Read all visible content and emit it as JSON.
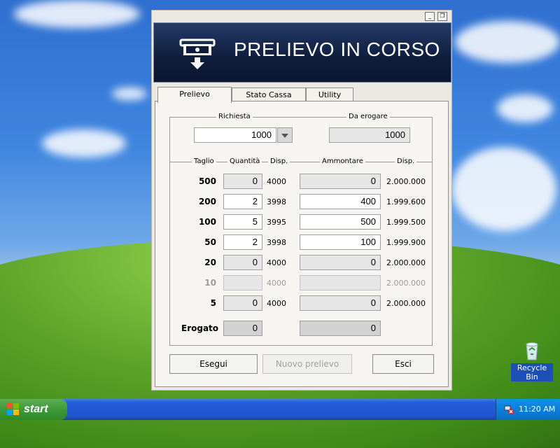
{
  "window": {
    "banner_title": "PRELIEVO IN CORSO",
    "minimize_glyph": "_",
    "restore_glyph": "❐"
  },
  "tabs": [
    {
      "label": "Prelievo",
      "active": true
    },
    {
      "label": "Stato Cassa",
      "active": false
    },
    {
      "label": "Utility",
      "active": false
    }
  ],
  "request": {
    "richiesta_label": "Richiesta",
    "richiesta_value": "1000",
    "da_erogare_label": "Da erogare",
    "da_erogare_value": "1000"
  },
  "table": {
    "headers": {
      "taglio": "Taglio",
      "quantita": "Quantità",
      "disp": "Disp.",
      "ammontare": "Ammontare",
      "disp2": "Disp."
    },
    "rows": [
      {
        "taglio": "500",
        "quantita": "0",
        "disp": "4000",
        "ammontare": "0",
        "disp_amount": "2.000.000",
        "enabled": true
      },
      {
        "taglio": "200",
        "quantita": "2",
        "disp": "3998",
        "ammontare": "400",
        "disp_amount": "1.999.600",
        "enabled": true
      },
      {
        "taglio": "100",
        "quantita": "5",
        "disp": "3995",
        "ammontare": "500",
        "disp_amount": "1.999.500",
        "enabled": true
      },
      {
        "taglio": "50",
        "quantita": "2",
        "disp": "3998",
        "ammontare": "100",
        "disp_amount": "1.999.900",
        "enabled": true
      },
      {
        "taglio": "20",
        "quantita": "0",
        "disp": "4000",
        "ammontare": "0",
        "disp_amount": "2.000.000",
        "enabled": true
      },
      {
        "taglio": "10",
        "quantita": "",
        "disp": "4000",
        "ammontare": "",
        "disp_amount": "2.000.000",
        "enabled": false
      },
      {
        "taglio": "5",
        "quantita": "0",
        "disp": "4000",
        "ammontare": "0",
        "disp_amount": "2.000.000",
        "enabled": true
      }
    ],
    "erogato_label": "Erogato",
    "erogato_quantita": "0",
    "erogato_ammontare": "0"
  },
  "buttons": {
    "esegui": "Esegui",
    "nuovo_prelievo": "Nuovo prelievo",
    "esci": "Esci"
  },
  "desktop": {
    "recycle_bin_label": "Recycle Bin"
  },
  "taskbar": {
    "start_label": "start",
    "clock": "11:20 AM"
  },
  "colors": {
    "banner_bg": "#0f1d3c",
    "taskbar_blue": "#245edb",
    "start_green": "#3c9a35"
  }
}
